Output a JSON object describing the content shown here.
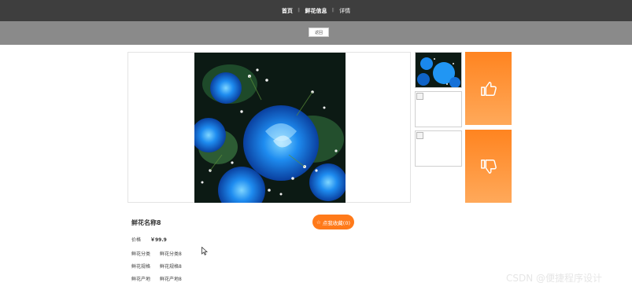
{
  "nav": {
    "home": "首页",
    "sep": "𝄃",
    "flower_info": "鲜花信息",
    "detail": "详情"
  },
  "toolbar": {
    "back_label": "返回"
  },
  "product": {
    "name": "鲜花名称8",
    "favorite_label": "点我收藏(0)",
    "favorite_icon": "☆",
    "price_label": "价格",
    "price_value": "￥99.9",
    "fields": [
      {
        "key": "鲜花分类",
        "value": "鲜花分类8"
      },
      {
        "key": "鲜花规格",
        "value": "鲜花规格8"
      },
      {
        "key": "鲜花产地",
        "value": "鲜花产地8"
      }
    ]
  },
  "side": {
    "like_icon": "thumbs-up-icon",
    "dislike_icon": "thumbs-down-icon",
    "accent": "#ff8420"
  },
  "watermark": "CSDN @便捷程序设计"
}
